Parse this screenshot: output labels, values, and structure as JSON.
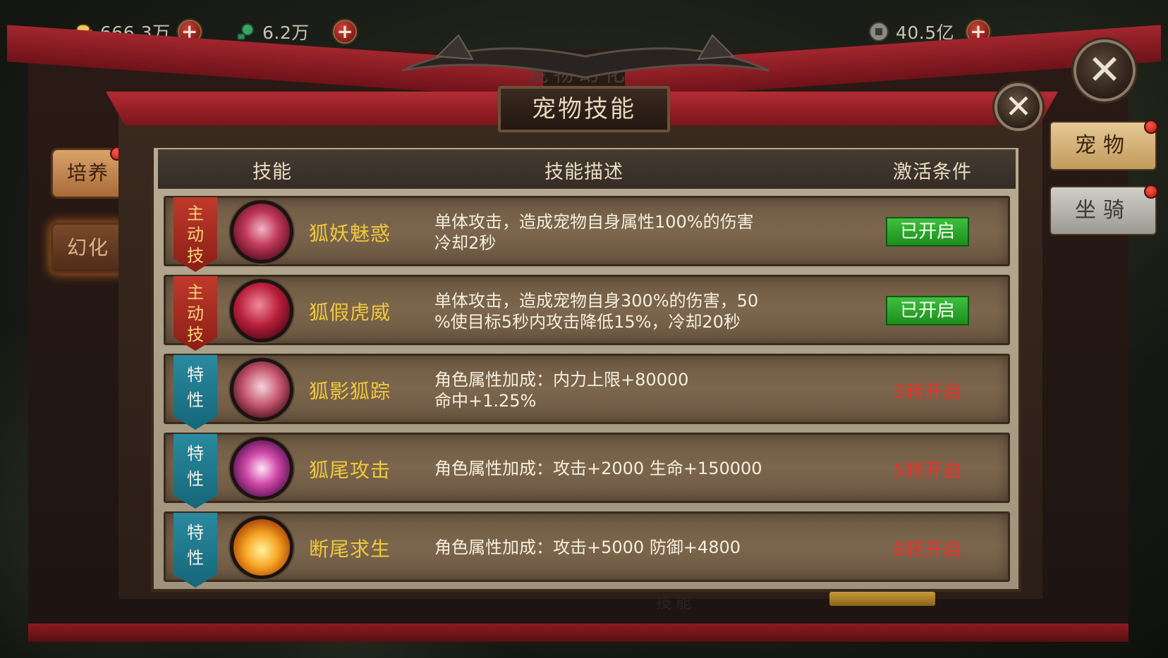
{
  "currencies": [
    {
      "icon": "gold-ingot-icon",
      "value": "666.3万"
    },
    {
      "icon": "jade-coin-icon",
      "value": "6.2万"
    },
    {
      "icon": "copper-coin-icon",
      "value": "40.5亿"
    }
  ],
  "plus_label": "+",
  "behind_title": "宠物幻化",
  "dialog": {
    "title": "宠物技能",
    "close_label": "✕"
  },
  "left_tabs": [
    {
      "label": "培养",
      "active": false
    },
    {
      "label": "幻化",
      "active": true
    }
  ],
  "right_tabs": [
    {
      "label": "宠物",
      "active": true
    },
    {
      "label": "坐骑",
      "active": false
    }
  ],
  "table": {
    "headers": {
      "skill": "技能",
      "description": "技能描述",
      "condition": "激活条件"
    },
    "rows": [
      {
        "type": "主动技",
        "type_kind": "active",
        "icon": "fox-charm-icon",
        "name": "狐妖魅惑",
        "description": "单体攻击，造成宠物自身属性100%的伤害\n冷却2秒",
        "status": "已开启",
        "unlocked": true
      },
      {
        "type": "主动技",
        "type_kind": "active",
        "icon": "fox-tiger-icon",
        "name": "狐假虎威",
        "description": "单体攻击，造成宠物自身300%的伤害，50\n%使目标5秒内攻击降低15%，冷却20秒",
        "status": "已开启",
        "unlocked": true
      },
      {
        "type": "特性",
        "type_kind": "trait",
        "icon": "fox-shadow-icon",
        "name": "狐影狐踪",
        "description": "角色属性加成：内力上限+80000\n命中+1.25%",
        "status": "3转开启",
        "unlocked": false
      },
      {
        "type": "特性",
        "type_kind": "trait",
        "icon": "fox-tail-icon",
        "name": "狐尾攻击",
        "description": "角色属性加成：攻击+2000 生命+150000",
        "status": "5转开启",
        "unlocked": false
      },
      {
        "type": "特性",
        "type_kind": "trait",
        "icon": "flame-tail-icon",
        "name": "断尾求生",
        "description": "角色属性加成：攻击+5000 防御+4800",
        "status": "8转开启",
        "unlocked": false
      }
    ]
  },
  "bottom_label": "技能",
  "colors": {
    "skill_name": "#f0c93c",
    "locked_status": "#e8332b",
    "unlocked_status": "#2ea82e",
    "active_ribbon": "#b03226",
    "trait_ribbon": "#2a8aa0"
  }
}
